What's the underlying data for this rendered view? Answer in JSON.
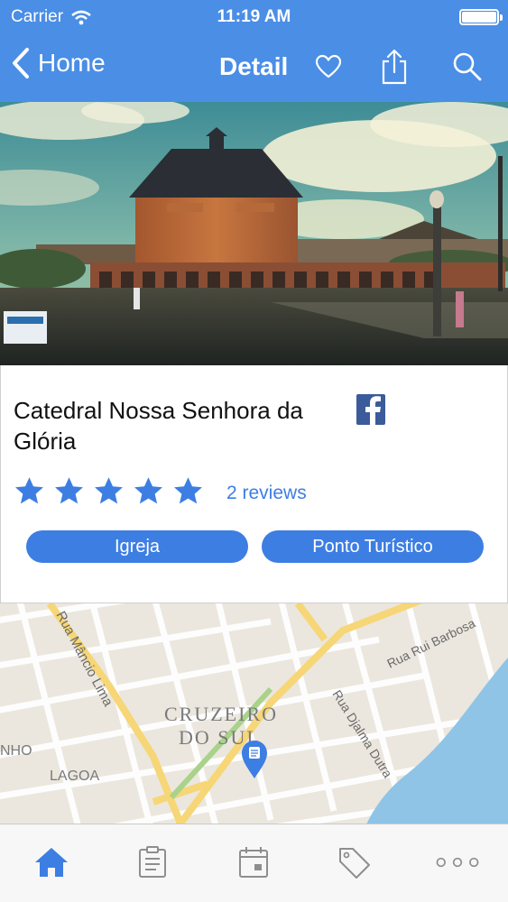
{
  "status_bar": {
    "carrier": "Carrier",
    "time": "11:19 AM"
  },
  "nav": {
    "back_label": "Home",
    "title": "Detail",
    "icons": [
      "heart-icon",
      "share-icon",
      "search-icon"
    ]
  },
  "hero": {
    "description_icon": "cathedral-photo"
  },
  "place": {
    "name": "Catedral Nossa Senhora da Glória",
    "rating": 5,
    "rating_max": 5,
    "reviews": "2 reviews",
    "tags": [
      "Igreja",
      "Ponto Turístico"
    ]
  },
  "map": {
    "city_line1": "CRUZEIRO",
    "city_line2": "DO SUL",
    "streets": [
      "Rua Mâncio Lima",
      "Rua Rui Barbosa",
      "Rua Djalma Dutra"
    ],
    "districts": [
      "LAGOA",
      "NHO"
    ]
  },
  "tab_bar": {
    "tabs": [
      "home-icon",
      "clipboard-icon",
      "calendar-icon",
      "tags-icon",
      "more-icon"
    ],
    "active": 0
  },
  "colors": {
    "accent": "#4a8ee6",
    "button": "#3d7ee3",
    "facebook": "#3b5b9a",
    "tab_inactive": "#8e8e8e"
  }
}
